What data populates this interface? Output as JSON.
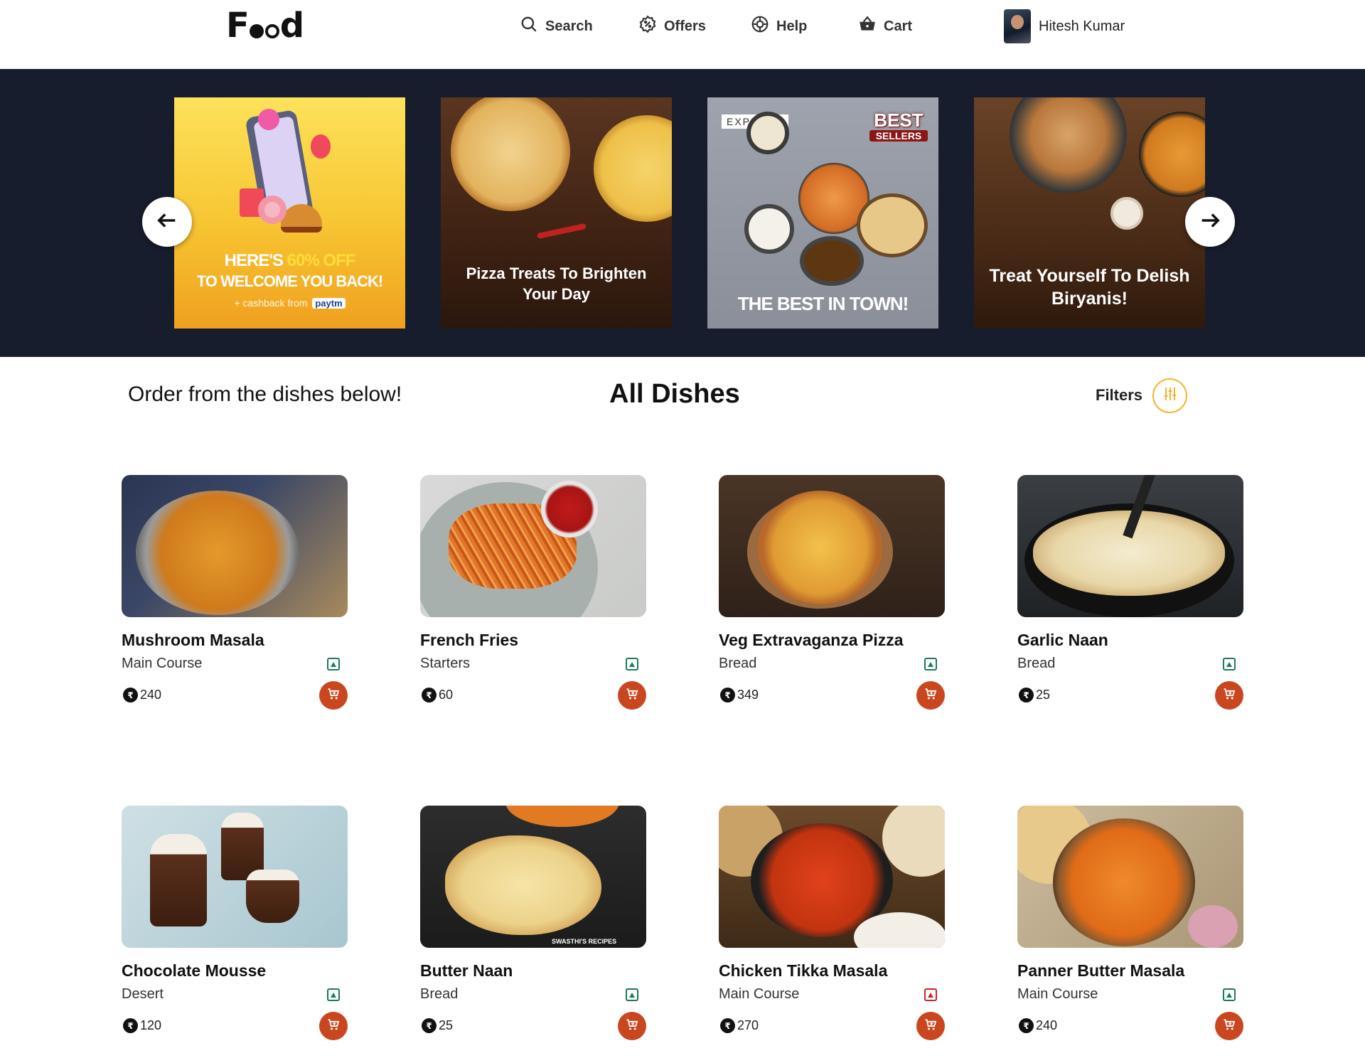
{
  "header": {
    "logo_text": "Food",
    "nav": [
      {
        "label": "Search",
        "icon": "search-icon"
      },
      {
        "label": "Offers",
        "icon": "offers-icon"
      },
      {
        "label": "Help",
        "icon": "help-icon"
      },
      {
        "label": "Cart",
        "icon": "cart-icon"
      }
    ],
    "user_name": "Hitesh Kumar"
  },
  "banner": {
    "promos": [
      {
        "line1a": "HERE'S ",
        "line1b": "60% OFF",
        "line2": "TO WELCOME YOU BACK!",
        "line3": "+ cashback from",
        "brand": "paytm"
      },
      {
        "text": "Pizza Treats To Brighten Your Day"
      },
      {
        "tag": "EXPLORE",
        "badge_top": "BEST",
        "badge_bottom": "SELLERS",
        "text": "THE BEST IN TOWN!"
      },
      {
        "text": "Treat Yourself To Delish Biryanis!"
      }
    ]
  },
  "section": {
    "order_text": "Order from the dishes below!",
    "title": "All Dishes",
    "filters_label": "Filters"
  },
  "dishes": [
    {
      "name": "Mushroom Masala",
      "category": "Main Course",
      "price": "240",
      "veg": true
    },
    {
      "name": "French Fries",
      "category": "Starters",
      "price": "60",
      "veg": true
    },
    {
      "name": "Veg Extravaganza Pizza",
      "category": "Bread",
      "price": "349",
      "veg": true
    },
    {
      "name": "Garlic Naan",
      "category": "Bread",
      "price": "25",
      "veg": true
    },
    {
      "name": "Chocolate Mousse",
      "category": "Desert",
      "price": "120",
      "veg": true
    },
    {
      "name": "Butter Naan",
      "category": "Bread",
      "price": "25",
      "veg": true,
      "watermark": "SWASTHI'S RECIPES"
    },
    {
      "name": "Chicken Tikka Masala",
      "category": "Main Course",
      "price": "270",
      "veg": false
    },
    {
      "name": "Panner Butter Masala",
      "category": "Main Course",
      "price": "240",
      "veg": true
    }
  ],
  "colors": {
    "banner_bg": "#171d2d",
    "accent_cart": "#c9461f",
    "filter_ring": "#f5b32a",
    "veg_green": "#1a7a5c",
    "nonveg_red": "#c62828"
  }
}
